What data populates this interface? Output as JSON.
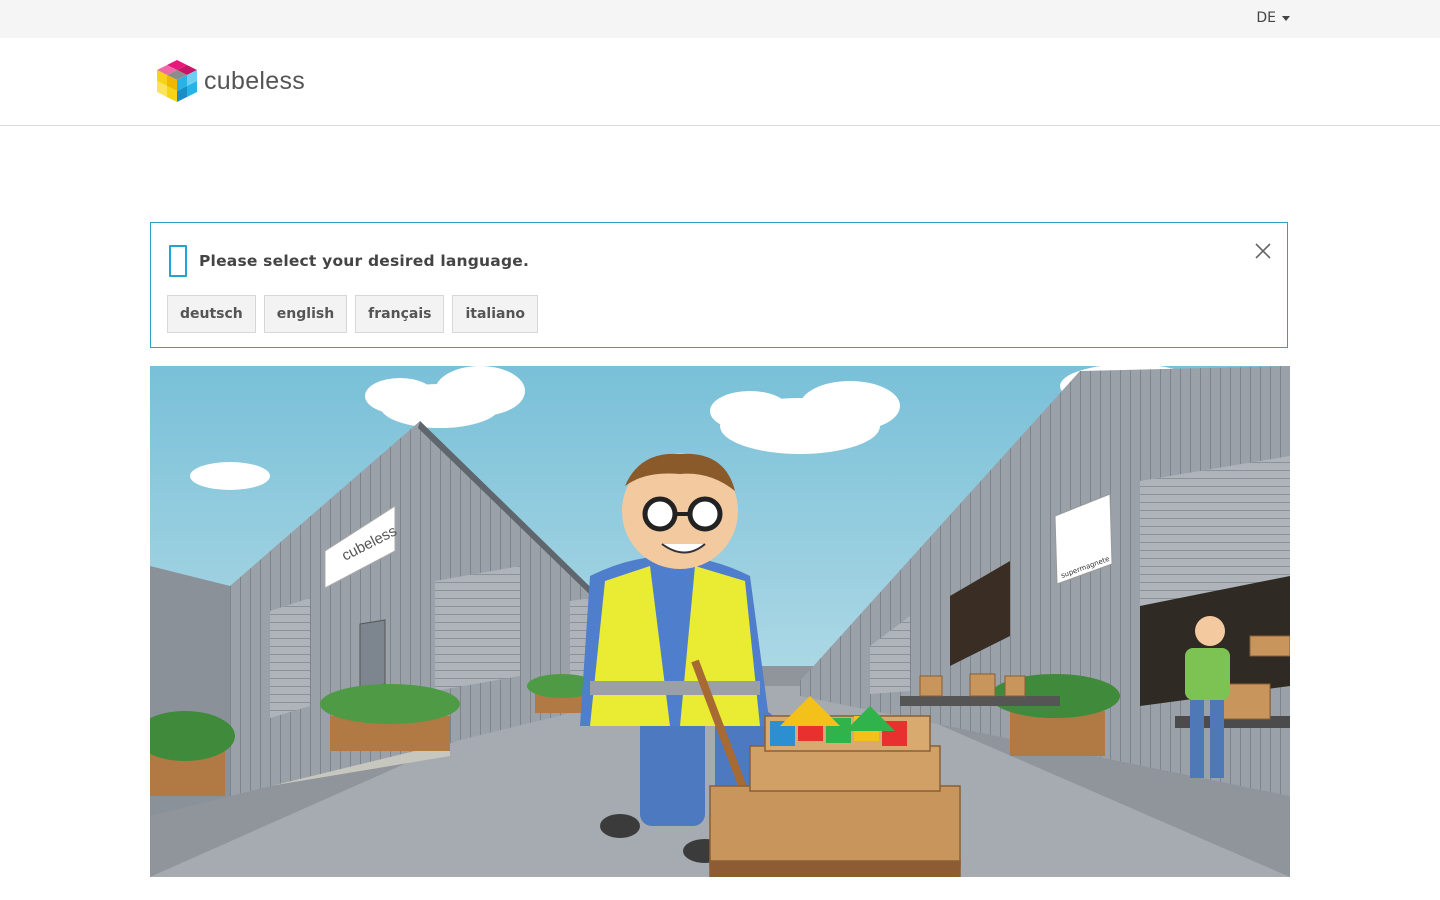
{
  "topbar": {
    "language_label": "DE"
  },
  "brand": {
    "name": "cubeless",
    "colors": {
      "magenta": "#e5197a",
      "cyan": "#25b3e8",
      "yellow": "#f7d417",
      "grey": "#8c8c8c"
    }
  },
  "language_alert": {
    "icon": "info-icon",
    "message": "Please select your desired language.",
    "buttons": [
      {
        "label": "deutsch"
      },
      {
        "label": "english"
      },
      {
        "label": "français"
      },
      {
        "label": "italiano"
      }
    ],
    "accent_color": "#2aa3c7"
  },
  "hero": {
    "sign_left": "cubeless",
    "sign_right": "supermagnete"
  }
}
